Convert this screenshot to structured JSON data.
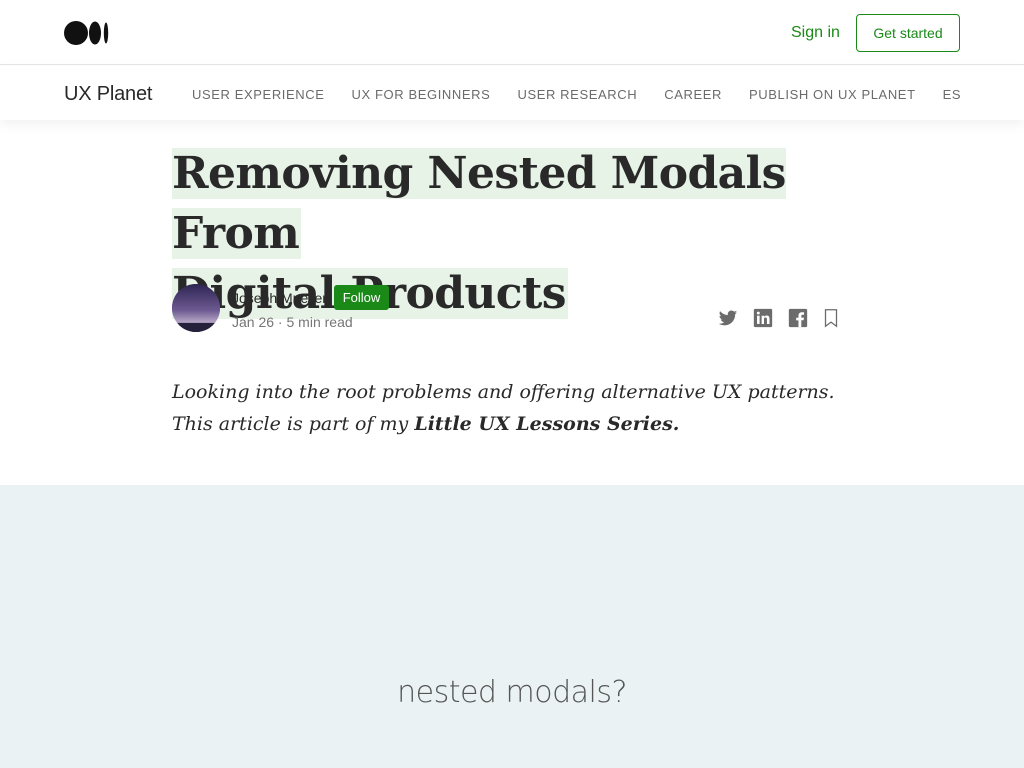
{
  "header": {
    "logo": "medium-logo-icon",
    "signin_label": "Sign in",
    "getstarted_label": "Get started",
    "accent_color": "#1a8917"
  },
  "publication": {
    "name": "UX Planet",
    "nav": [
      "USER EXPERIENCE",
      "UX FOR BEGINNERS",
      "USER RESEARCH",
      "CAREER",
      "PUBLISH ON UX PLANET",
      "ES"
    ]
  },
  "article": {
    "title_line1": "Removing Nested Modals From",
    "title_line2": "Digital Products",
    "author": "Joseph Mueller",
    "follow_label": "Follow",
    "date": "Jan 26",
    "separator": " · ",
    "read_time": "5 min read",
    "subtitle_line1": "Looking into the root problems and offering alternative UX patterns.",
    "subtitle_line2_prefix": "This article is part of my ",
    "subtitle_line2_bold": "Little UX Lessons Series."
  },
  "share_icons": [
    "twitter-icon",
    "linkedin-icon",
    "facebook-icon",
    "bookmark-icon"
  ],
  "hero": {
    "text": "nested modals?",
    "background": "#eaf2f3"
  }
}
